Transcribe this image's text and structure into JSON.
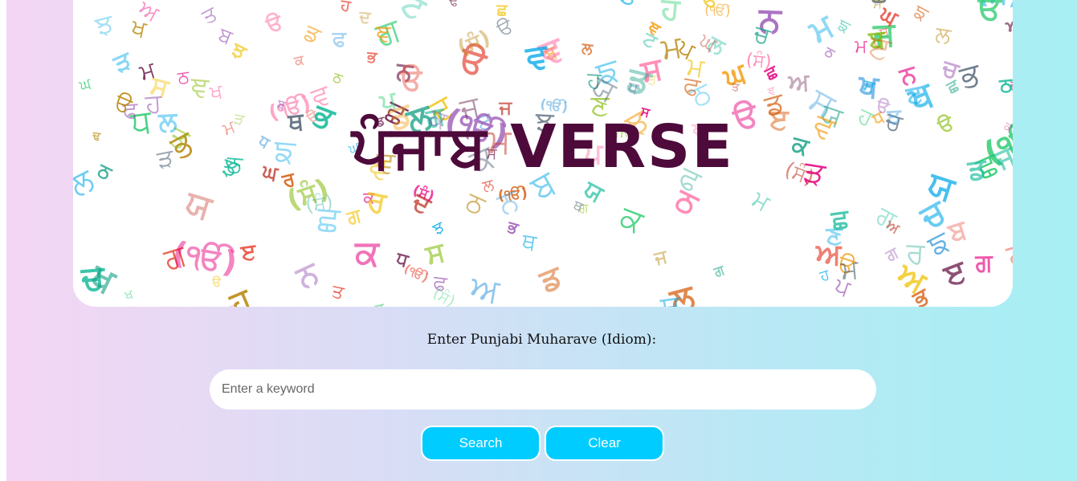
{
  "banner": {
    "title": "ਪੰਜਾਬ VERSE",
    "decor_glyphs": [
      "ਕ",
      "ਖ",
      "ਗ",
      "ਘ",
      "ਙ",
      "ਚ",
      "ਛ",
      "ਜ",
      "ਝ",
      "ਞ",
      "ਟ",
      "ਠ",
      "ਡ",
      "ਢ",
      "ਣ",
      "ਤ",
      "ਥ",
      "ਦ",
      "ਧ",
      "ਨ",
      "ਪ",
      "ਫ",
      "ਬ",
      "ਭ",
      "ਮ",
      "ਯ",
      "ਰ",
      "ਲ",
      "ਵ",
      "ੜ",
      "ੳ",
      "ਅ",
      "ੲ",
      "ਸ",
      "ਹ",
      "(ੴ)",
      "(ਸੰ)"
    ],
    "decor_colors": [
      "#e6007e",
      "#f39c12",
      "#2ecc71",
      "#3498db",
      "#9b59b6",
      "#e74c3c",
      "#1abc9c",
      "#c0392b",
      "#8e44ad",
      "#d35400",
      "#16a085",
      "#f1c40f",
      "#34495e",
      "#ff6fa5",
      "#7fb800",
      "#00a8e8",
      "#6d214f",
      "#b8860b"
    ]
  },
  "form": {
    "label": "Enter Punjabi Muharave (Idiom):",
    "input_placeholder": "Enter a keyword",
    "input_value": "",
    "search_label": "Search",
    "clear_label": "Clear"
  },
  "colors": {
    "title": "#4d0a3a",
    "button": "#00ccff",
    "gradient_left": "#f4d6f4",
    "gradient_right": "#a6eff3"
  }
}
